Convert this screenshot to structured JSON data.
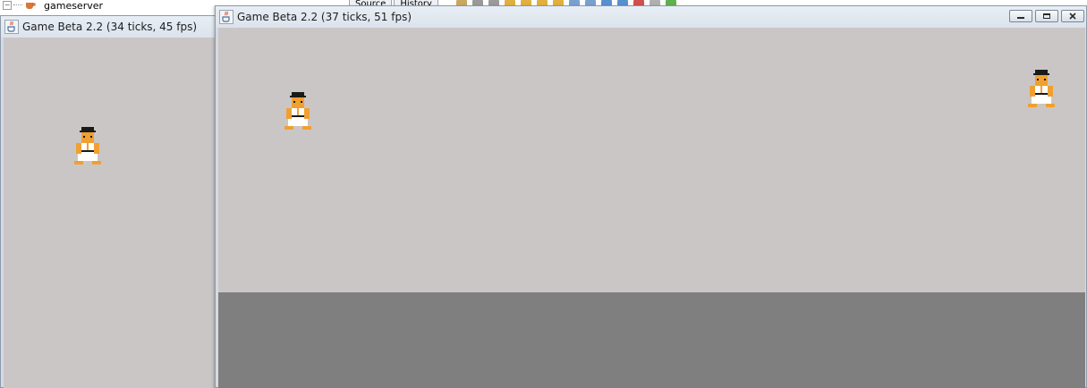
{
  "ide": {
    "tree_item": "gameserver",
    "tabs": [
      "Source",
      "History"
    ]
  },
  "windows": {
    "left": {
      "title": "Game Beta 2.2 (34 ticks, 45 fps)"
    },
    "main": {
      "title": "Game Beta 2.2 (37 ticks, 51 fps)"
    }
  },
  "colors": {
    "tile_light": "#cbc6c6",
    "tile_dark": "#b2aeae",
    "void": "#7f7f7f",
    "skin": "#f0a030",
    "hair": "#1a1a1a",
    "gi": "#ffffff"
  },
  "icons": {
    "title": "java-cup-icon",
    "minimize": "minimize-icon",
    "maximize": "maximize-icon",
    "close": "close-icon",
    "player": "player-sprite"
  }
}
